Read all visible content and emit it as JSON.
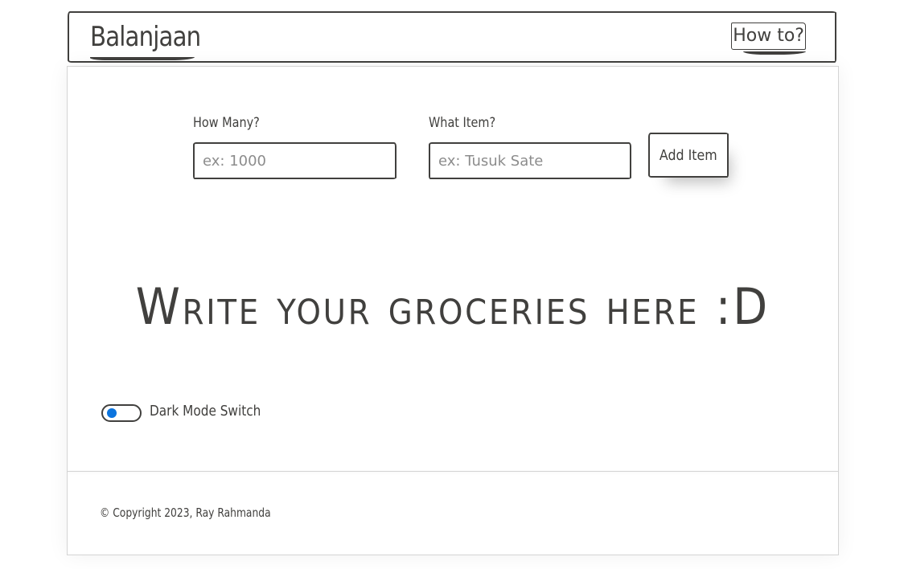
{
  "navbar": {
    "brand": "Balanjaan",
    "howto_label": "How to?"
  },
  "form": {
    "quantity": {
      "label": "How Many?",
      "placeholder": "ex: 1000",
      "value": ""
    },
    "item": {
      "label": "What Item?",
      "placeholder": "ex: Tusuk Sate",
      "value": ""
    },
    "add_button_label": "Add Item"
  },
  "main": {
    "empty_message": "Write your groceries here :D"
  },
  "dark_mode": {
    "label": "Dark Mode Switch",
    "enabled": false,
    "knob_color": "#0b74de"
  },
  "footer": {
    "copyright": "© Copyright 2023, Ray Rahmanda"
  },
  "colors": {
    "ink": "#41403e",
    "accent": "#0b74de",
    "border_light": "#d4d4d4"
  }
}
